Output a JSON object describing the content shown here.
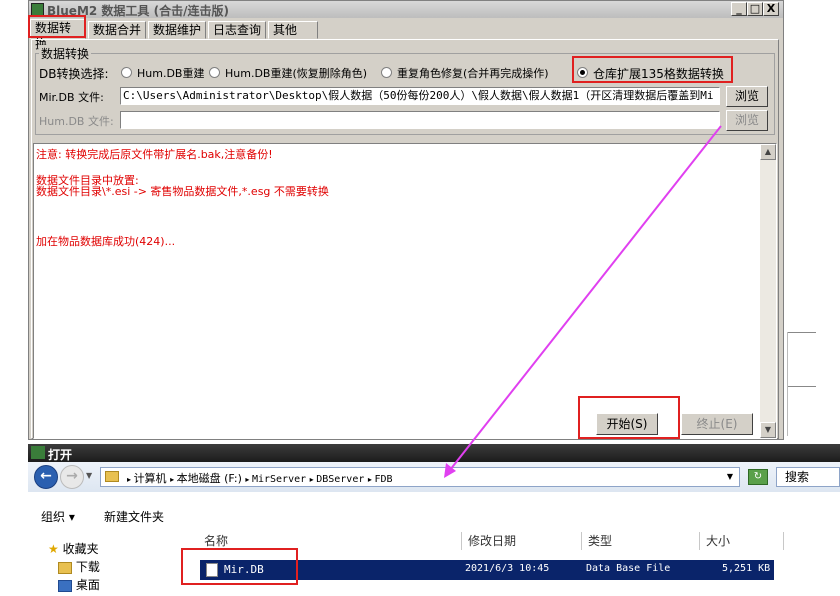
{
  "window": {
    "title": "BlueM2 数据工具 (合击/连击版)",
    "controls": {
      "minimize": "_",
      "maximize": "□",
      "close": "X"
    }
  },
  "tabs": [
    "数据转换",
    "数据合并",
    "数据维护",
    "日志查询",
    "其他"
  ],
  "group": {
    "title": "数据转换",
    "db_convert_label": "DB转换选择:",
    "options": [
      {
        "label": "Hum.DB重建",
        "checked": false
      },
      {
        "label": "Hum.DB重建(恢复删除角色)",
        "checked": false
      },
      {
        "label": "重复角色修复(合并再完成操作)",
        "checked": false
      },
      {
        "label": "仓库扩展135格数据转换",
        "checked": true
      }
    ],
    "mir_db": {
      "label": "Mir.DB 文件:",
      "value": "C:\\Users\\Administrator\\Desktop\\假人数据（50份每份200人）\\假人数据\\假人数据1（开区清理数据后覆盖到Mi",
      "browse": "浏览"
    },
    "hum_db": {
      "label": "Hum.DB 文件:",
      "value": "",
      "browse": "浏览"
    }
  },
  "log": {
    "lines": [
      "注意: 转换完成后原文件带扩展名.bak,注意备份!",
      "",
      "数据文件目录中放置:",
      "数据文件目录\\*.esi      ->  寄售物品数据文件,*.esg 不需要转换",
      "",
      "",
      "",
      "加在物品数据库成功(424)..."
    ]
  },
  "buttons": {
    "start": "开始(S)",
    "stop": "终止(E)"
  },
  "open_dialog": {
    "title": "打开",
    "breadcrumb": [
      "计算机",
      "本地磁盘 (F:)",
      "MirServer",
      "DBServer",
      "FDB"
    ],
    "search_label": "搜索",
    "toolbar": {
      "organize": "组织 ▾",
      "new_folder": "新建文件夹"
    },
    "sidebar": [
      "收藏夹",
      "下载",
      "桌面"
    ],
    "columns": [
      "名称",
      "修改日期",
      "类型",
      "大小"
    ],
    "files": [
      {
        "name": "Mir.DB",
        "modified": "2021/6/3 10:45",
        "type": "Data Base File",
        "size": "5,251 KB"
      }
    ]
  },
  "colors": {
    "highlight_box": "#e02020",
    "arrow": "#e040f0",
    "log_text": "#e00000",
    "selection": "#0a246a"
  }
}
